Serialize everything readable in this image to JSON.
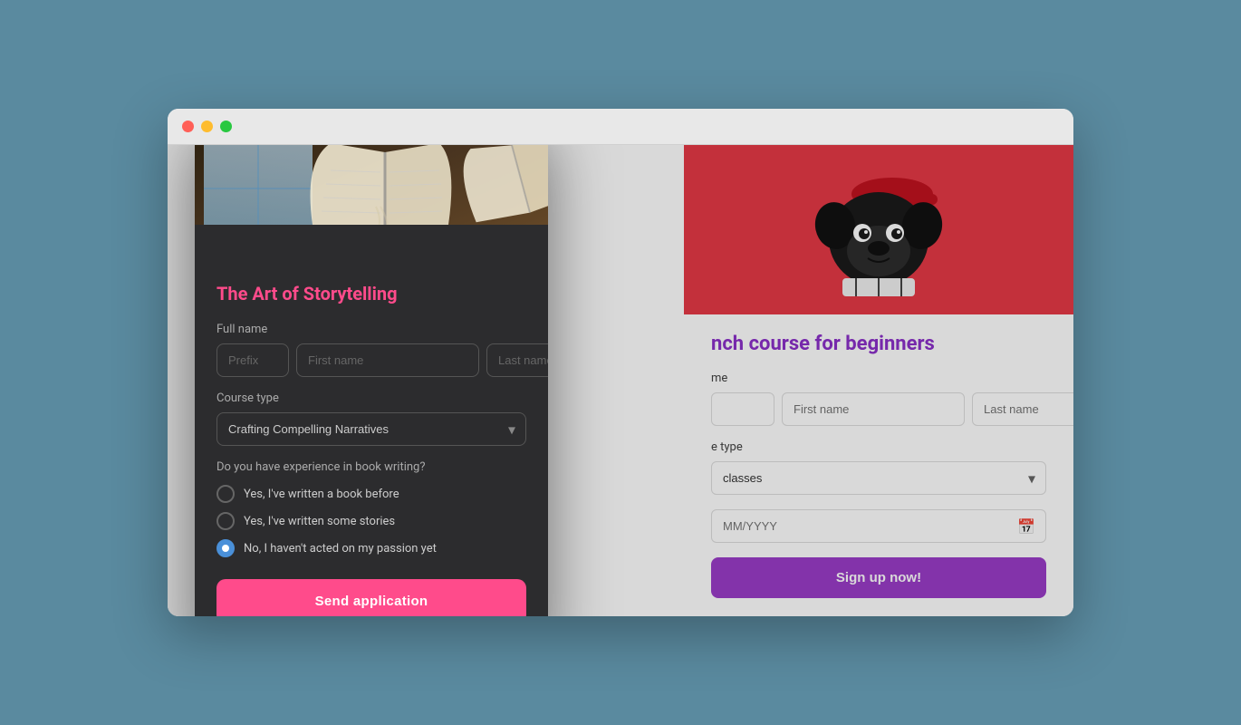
{
  "browser": {
    "traffic_lights": {
      "close": "close",
      "minimize": "minimize",
      "maximize": "maximize"
    }
  },
  "background_page": {
    "course_title": "nch course for beginners",
    "full_name_label": "me",
    "name_fields": {
      "prefix_placeholder": "",
      "first_placeholder": "First name",
      "last_placeholder": "Last name"
    },
    "course_type_label": "e type",
    "course_type_value": "classes",
    "date_placeholder": "MM/YYYY",
    "signup_button": "Sign up now!"
  },
  "modal": {
    "title": "The Art of Storytelling",
    "full_name_label": "Full name",
    "name_fields": {
      "prefix_placeholder": "Prefix",
      "first_placeholder": "First name",
      "last_placeholder": "Last name"
    },
    "course_type_label": "Course type",
    "course_type_value": "Crafting Compelling Narratives",
    "experience_label": "Do you have experience in book writing?",
    "radio_options": [
      {
        "id": "opt1",
        "label": "Yes, I've written a book before",
        "selected": false
      },
      {
        "id": "opt2",
        "label": "Yes, I've written some stories",
        "selected": false
      },
      {
        "id": "opt3",
        "label": "No, I haven't acted on my passion yet",
        "selected": true
      }
    ],
    "send_button": "Send application"
  }
}
